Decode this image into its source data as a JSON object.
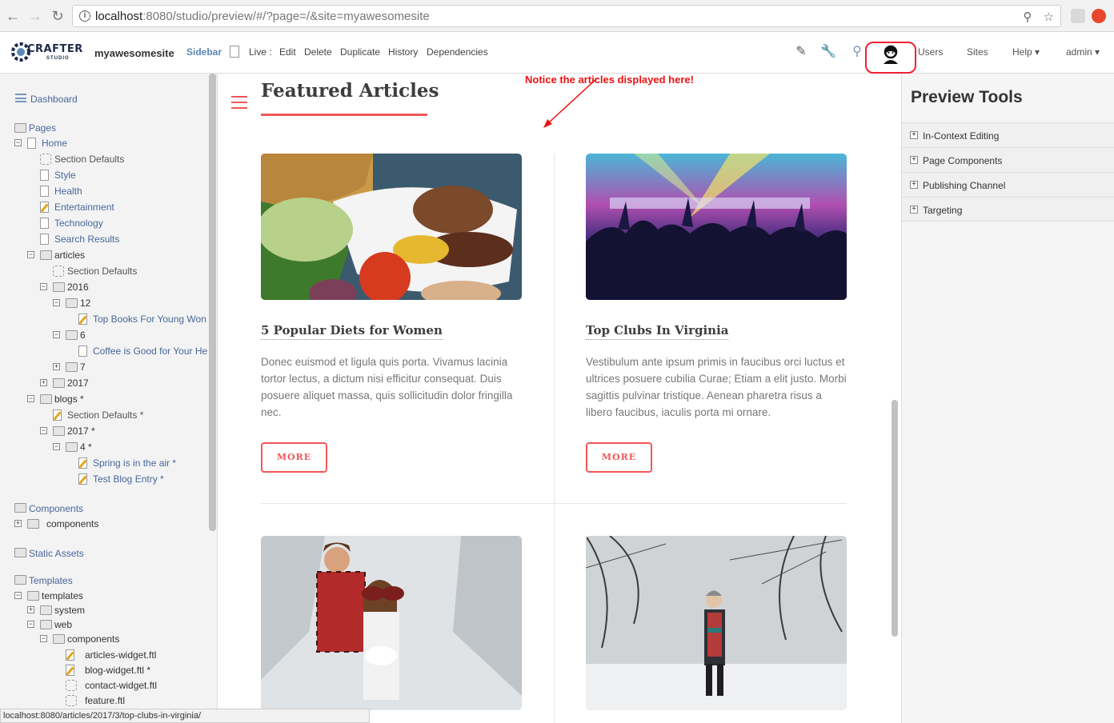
{
  "browser": {
    "url_host": "localhost",
    "url_rest": ":8080/studio/preview/#/?page=/&site=myawesomesite"
  },
  "toolbar": {
    "logo_text": "CRAFTER",
    "logo_sub": "STUDIO",
    "site_name": "myawesomesite",
    "sidebar_label": "Sidebar",
    "live_label": "Live :",
    "actions": [
      "Edit",
      "Delete",
      "Duplicate",
      "History",
      "Dependencies"
    ],
    "users": "Users",
    "sites": "Sites",
    "help": "Help ▾",
    "admin": "admin ▾"
  },
  "sidebar": {
    "dashboard": "Dashboard",
    "pages": "Pages",
    "components": "Components",
    "static_assets": "Static Assets",
    "templates": "Templates",
    "tree": [
      "Home",
      "Section Defaults",
      "Style",
      "Health",
      "Entertainment",
      "Technology",
      "Search Results",
      "articles",
      "Section Defaults",
      "2016",
      "12",
      "Top Books For Young Won",
      "6",
      "Coffee is Good for Your He",
      "7",
      "2017",
      "blogs *",
      "Section Defaults *",
      "2017 *",
      "4 *",
      "Spring is in the air *",
      "Test Blog Entry *"
    ],
    "component_tree": [
      "components"
    ],
    "template_tree": [
      "templates",
      "system",
      "web",
      "components",
      "articles-widget.ftl",
      "blog-widget.ftl *",
      "contact-widget.ftl",
      "feature.ftl"
    ]
  },
  "main": {
    "title": "Featured Articles",
    "notice": "Notice the articles displayed here!",
    "articles": [
      {
        "title": "5 Popular Diets for Women",
        "text": "Donec euismod et ligula quis porta. Vivamus lacinia tortor lectus, a dictum nisi efficitur consequat. Duis posuere aliquet massa, quis sollicitudin dolor fringilla nec.",
        "button": "MORE"
      },
      {
        "title": "Top Clubs In Virginia",
        "text": "Vestibulum ante ipsum primis in faucibus orci luctus et ultrices posuere cubilia Curae; Etiam a elit justo. Morbi sagittis pulvinar tristique. Aenean pharetra risus a libero faucibus, iaculis porta mi ornare.",
        "button": "MORE"
      }
    ]
  },
  "preview_tools": {
    "title": "Preview Tools",
    "items": [
      "In-Context Editing",
      "Page Components",
      "Publishing Channel",
      "Targeting"
    ]
  },
  "status_url": "localhost:8080/articles/2017/3/top-clubs-in-virginia/"
}
